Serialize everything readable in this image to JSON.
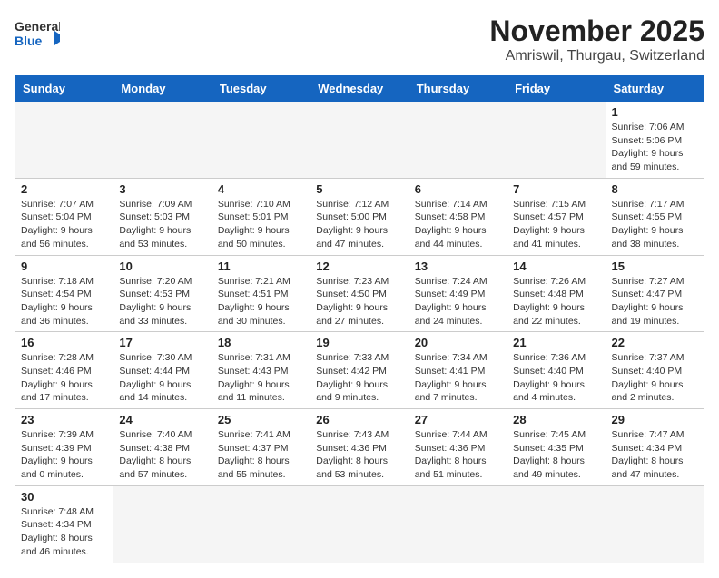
{
  "header": {
    "logo_general": "General",
    "logo_blue": "Blue",
    "title": "November 2025",
    "subtitle": "Amriswil, Thurgau, Switzerland"
  },
  "days_of_week": [
    "Sunday",
    "Monday",
    "Tuesday",
    "Wednesday",
    "Thursday",
    "Friday",
    "Saturday"
  ],
  "weeks": [
    {
      "days": [
        {
          "num": "",
          "info": ""
        },
        {
          "num": "",
          "info": ""
        },
        {
          "num": "",
          "info": ""
        },
        {
          "num": "",
          "info": ""
        },
        {
          "num": "",
          "info": ""
        },
        {
          "num": "",
          "info": ""
        },
        {
          "num": "1",
          "info": "Sunrise: 7:06 AM\nSunset: 5:06 PM\nDaylight: 9 hours\nand 59 minutes."
        }
      ]
    },
    {
      "days": [
        {
          "num": "2",
          "info": "Sunrise: 7:07 AM\nSunset: 5:04 PM\nDaylight: 9 hours\nand 56 minutes."
        },
        {
          "num": "3",
          "info": "Sunrise: 7:09 AM\nSunset: 5:03 PM\nDaylight: 9 hours\nand 53 minutes."
        },
        {
          "num": "4",
          "info": "Sunrise: 7:10 AM\nSunset: 5:01 PM\nDaylight: 9 hours\nand 50 minutes."
        },
        {
          "num": "5",
          "info": "Sunrise: 7:12 AM\nSunset: 5:00 PM\nDaylight: 9 hours\nand 47 minutes."
        },
        {
          "num": "6",
          "info": "Sunrise: 7:14 AM\nSunset: 4:58 PM\nDaylight: 9 hours\nand 44 minutes."
        },
        {
          "num": "7",
          "info": "Sunrise: 7:15 AM\nSunset: 4:57 PM\nDaylight: 9 hours\nand 41 minutes."
        },
        {
          "num": "8",
          "info": "Sunrise: 7:17 AM\nSunset: 4:55 PM\nDaylight: 9 hours\nand 38 minutes."
        }
      ]
    },
    {
      "days": [
        {
          "num": "9",
          "info": "Sunrise: 7:18 AM\nSunset: 4:54 PM\nDaylight: 9 hours\nand 36 minutes."
        },
        {
          "num": "10",
          "info": "Sunrise: 7:20 AM\nSunset: 4:53 PM\nDaylight: 9 hours\nand 33 minutes."
        },
        {
          "num": "11",
          "info": "Sunrise: 7:21 AM\nSunset: 4:51 PM\nDaylight: 9 hours\nand 30 minutes."
        },
        {
          "num": "12",
          "info": "Sunrise: 7:23 AM\nSunset: 4:50 PM\nDaylight: 9 hours\nand 27 minutes."
        },
        {
          "num": "13",
          "info": "Sunrise: 7:24 AM\nSunset: 4:49 PM\nDaylight: 9 hours\nand 24 minutes."
        },
        {
          "num": "14",
          "info": "Sunrise: 7:26 AM\nSunset: 4:48 PM\nDaylight: 9 hours\nand 22 minutes."
        },
        {
          "num": "15",
          "info": "Sunrise: 7:27 AM\nSunset: 4:47 PM\nDaylight: 9 hours\nand 19 minutes."
        }
      ]
    },
    {
      "days": [
        {
          "num": "16",
          "info": "Sunrise: 7:28 AM\nSunset: 4:46 PM\nDaylight: 9 hours\nand 17 minutes."
        },
        {
          "num": "17",
          "info": "Sunrise: 7:30 AM\nSunset: 4:44 PM\nDaylight: 9 hours\nand 14 minutes."
        },
        {
          "num": "18",
          "info": "Sunrise: 7:31 AM\nSunset: 4:43 PM\nDaylight: 9 hours\nand 11 minutes."
        },
        {
          "num": "19",
          "info": "Sunrise: 7:33 AM\nSunset: 4:42 PM\nDaylight: 9 hours\nand 9 minutes."
        },
        {
          "num": "20",
          "info": "Sunrise: 7:34 AM\nSunset: 4:41 PM\nDaylight: 9 hours\nand 7 minutes."
        },
        {
          "num": "21",
          "info": "Sunrise: 7:36 AM\nSunset: 4:40 PM\nDaylight: 9 hours\nand 4 minutes."
        },
        {
          "num": "22",
          "info": "Sunrise: 7:37 AM\nSunset: 4:40 PM\nDaylight: 9 hours\nand 2 minutes."
        }
      ]
    },
    {
      "days": [
        {
          "num": "23",
          "info": "Sunrise: 7:39 AM\nSunset: 4:39 PM\nDaylight: 9 hours\nand 0 minutes."
        },
        {
          "num": "24",
          "info": "Sunrise: 7:40 AM\nSunset: 4:38 PM\nDaylight: 8 hours\nand 57 minutes."
        },
        {
          "num": "25",
          "info": "Sunrise: 7:41 AM\nSunset: 4:37 PM\nDaylight: 8 hours\nand 55 minutes."
        },
        {
          "num": "26",
          "info": "Sunrise: 7:43 AM\nSunset: 4:36 PM\nDaylight: 8 hours\nand 53 minutes."
        },
        {
          "num": "27",
          "info": "Sunrise: 7:44 AM\nSunset: 4:36 PM\nDaylight: 8 hours\nand 51 minutes."
        },
        {
          "num": "28",
          "info": "Sunrise: 7:45 AM\nSunset: 4:35 PM\nDaylight: 8 hours\nand 49 minutes."
        },
        {
          "num": "29",
          "info": "Sunrise: 7:47 AM\nSunset: 4:34 PM\nDaylight: 8 hours\nand 47 minutes."
        }
      ]
    },
    {
      "days": [
        {
          "num": "30",
          "info": "Sunrise: 7:48 AM\nSunset: 4:34 PM\nDaylight: 8 hours\nand 46 minutes."
        },
        {
          "num": "",
          "info": ""
        },
        {
          "num": "",
          "info": ""
        },
        {
          "num": "",
          "info": ""
        },
        {
          "num": "",
          "info": ""
        },
        {
          "num": "",
          "info": ""
        },
        {
          "num": "",
          "info": ""
        }
      ]
    }
  ]
}
